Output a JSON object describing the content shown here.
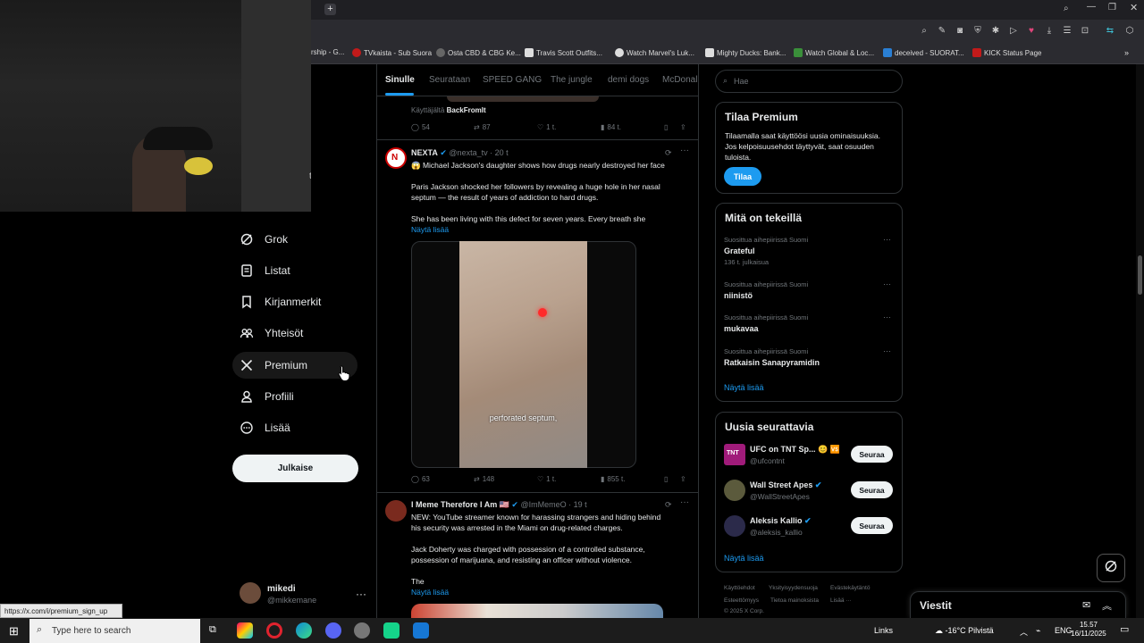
{
  "browser": {
    "bookmarks": [
      {
        "label": "rship - G...",
        "color": "#555"
      },
      {
        "label": "TVkaista - Sub Suora",
        "color": "#c21a1a"
      },
      {
        "label": "Osta CBD & CBG Ke...",
        "color": "#666"
      },
      {
        "label": "Travis Scott Outfits...",
        "color": "#ddd"
      },
      {
        "label": "Watch Marvel's Luk...",
        "color": "#ddd"
      },
      {
        "label": "Mighty Ducks: Bank...",
        "color": "#ddd"
      },
      {
        "label": "Watch Global & Loc...",
        "color": "#3a8f3a"
      },
      {
        "label": "deceived - SUORAT...",
        "color": "#2a7fd4"
      },
      {
        "label": "KICK Status Page",
        "color": "#c21a1a"
      }
    ],
    "status_url": "https://x.com/i/premium_sign_up"
  },
  "nav": {
    "partial_label": "t",
    "items": [
      {
        "label": "Grok"
      },
      {
        "label": "Listat"
      },
      {
        "label": "Kirjanmerkit"
      },
      {
        "label": "Yhteisöt"
      },
      {
        "label": "Premium"
      },
      {
        "label": "Profiili"
      },
      {
        "label": "Lisää"
      }
    ],
    "post_label": "Julkaise",
    "account": {
      "name": "mikedi",
      "handle": "@mikkemane",
      "more": "···"
    }
  },
  "tabs": [
    {
      "label": "Sinulle"
    },
    {
      "label": "Seurataan"
    },
    {
      "label": "SPEED GANG"
    },
    {
      "label": "The jungle"
    },
    {
      "label": "demi dogs"
    },
    {
      "label": "McDonal"
    }
  ],
  "tweet0": {
    "byline_prefix": "Käyttäjältä",
    "byline_user": "BackFromIt",
    "replies": "54",
    "reposts": "87",
    "likes": "1 t.",
    "views": "84 t."
  },
  "tweet1": {
    "name": "NEXTA",
    "handle": "@nexta_tv",
    "time": "· 20 t",
    "line1": "😱 Michael Jackson's daughter shows how drugs nearly destroyed her face",
    "line2": "Paris Jackson shocked her followers by revealing a huge hole in her nasal",
    "line3": "septum — the result of years of addiction to hard drugs.",
    "line4": "She has been living with this defect for seven years. Every breath she",
    "show_more": "Näytä lisää",
    "media_caption": "perforated septum,",
    "replies": "63",
    "reposts": "148",
    "likes": "1 t.",
    "views": "855 t."
  },
  "tweet2": {
    "name": "I Meme Therefore I Am 🇺🇸",
    "handle": "@ImMemeO",
    "time": "· 19 t",
    "line1": "NEW: YouTube streamer known for harassing strangers and hiding behind",
    "line2": "his security was arrested in the Miami on drug-related charges.",
    "line3": "Jack Doherty was charged with possession of a controlled substance,",
    "line4": "possession of marijuana, and resisting an officer without violence.",
    "line5": "The",
    "show_more": "Näytä lisää"
  },
  "search": {
    "placeholder": "Hae"
  },
  "premium": {
    "title": "Tilaa Premium",
    "line1": "Tilaamalla saat käyttöösi uusia ominaisuuksia.",
    "line2": "Jos kelpoisuusehdot täyttyvät, saat osuuden",
    "line3": "tuloista.",
    "button": "Tilaa"
  },
  "trends": {
    "title": "Mitä on tekeillä",
    "items": [
      {
        "context": "Suosittua aihepiirissä Suomi",
        "name": "Grateful",
        "count": "136 t. julkaisua"
      },
      {
        "context": "Suosittua aihepiirissä Suomi",
        "name": "niinistö",
        "count": ""
      },
      {
        "context": "Suosittua aihepiirissä Suomi",
        "name": "mukavaa",
        "count": ""
      },
      {
        "context": "Suosittua aihepiirissä Suomi",
        "name": "Ratkaisin Sanapyramidin",
        "count": ""
      }
    ],
    "show_more": "Näytä lisää"
  },
  "follow": {
    "title": "Uusia seurattavia",
    "items": [
      {
        "name": "UFC on TNT Sp... 😊 🆚",
        "handle": "@ufcontnt",
        "button": "Seuraa"
      },
      {
        "name": "Wall Street Apes",
        "handle": "@WallStreetApes",
        "button": "Seuraa"
      },
      {
        "name": "Aleksis Kallio",
        "handle": "@aleksis_kallio",
        "button": "Seuraa"
      }
    ],
    "show_more": "Näytä lisää"
  },
  "footer": {
    "l1": [
      "Käyttöehdot",
      "Yksityisyydensuoja",
      "Evästekäytäntö"
    ],
    "l2": [
      "Esteettömyys",
      "Tietoa mainoksista",
      "Lisää ···"
    ],
    "copyright": "© 2025 X Corp."
  },
  "messages": {
    "title": "Viestit"
  },
  "taskbar": {
    "search_placeholder": "Type here to search",
    "links": "Links",
    "weather": "-16°C Pilvistä",
    "lang": "ENG",
    "time": "15.57",
    "date": "16/11/2025"
  },
  "colors": {
    "accent": "#1d9bf0",
    "background": "#000000",
    "border": "#2f3336",
    "muted": "#71767b"
  }
}
